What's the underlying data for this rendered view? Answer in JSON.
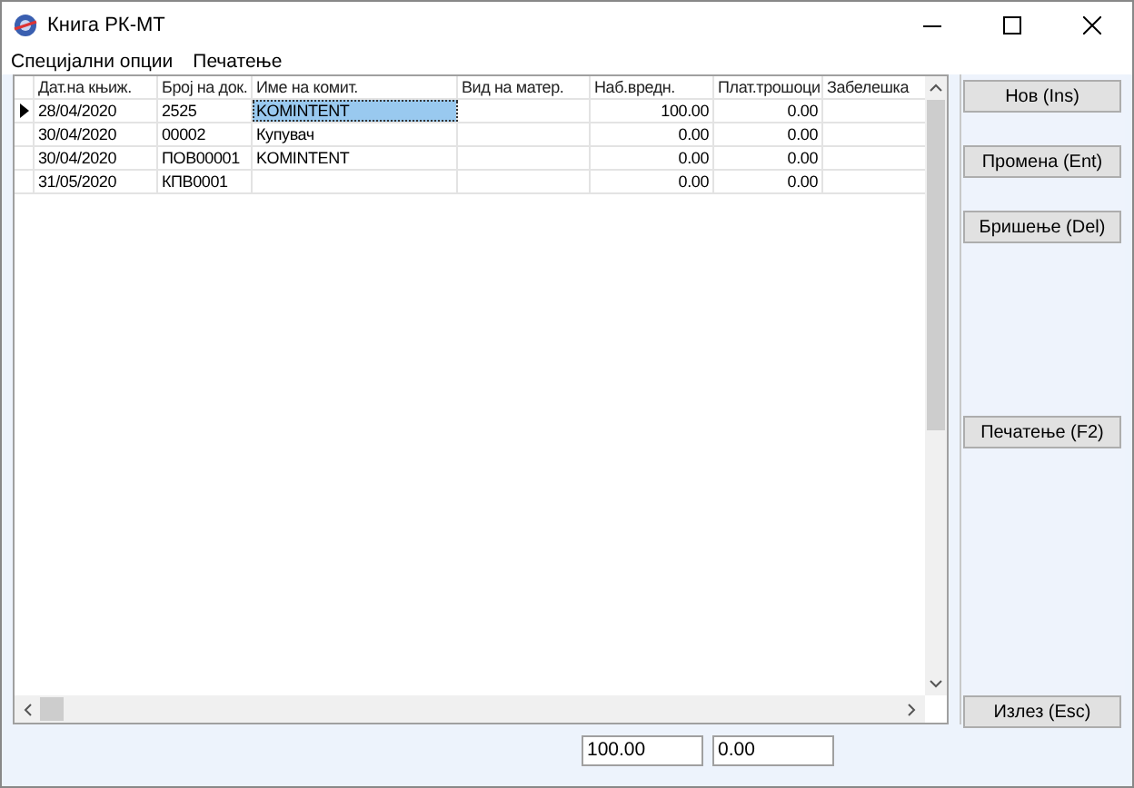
{
  "window": {
    "title": "Книга РК-МТ"
  },
  "menu": [
    "Специјални опции",
    "Печатење"
  ],
  "table": {
    "columns": [
      "Дат.на књиж.",
      "Број на док.",
      "Име на комит.",
      "Вид на матер.",
      "Наб.вредн.",
      "Плат.трошоци",
      "Забелешка"
    ],
    "rows": [
      {
        "current": true,
        "client_selected": true,
        "date": "28/04/2020",
        "doc_no": "2525",
        "client": "KOMINTENT",
        "value": "100.00",
        "costs": "0.00"
      },
      {
        "current": false,
        "client_selected": false,
        "date": "30/04/2020",
        "doc_no": "00002",
        "client": "Купувач",
        "value": "0.00",
        "costs": "0.00"
      },
      {
        "current": false,
        "client_selected": false,
        "date": "30/04/2020",
        "doc_no": "ПОВ00001",
        "client": "KOMINTENT",
        "value": "0.00",
        "costs": "0.00"
      },
      {
        "current": false,
        "client_selected": false,
        "date": "31/05/2020",
        "doc_no": "КПВ0001",
        "value": "0.00",
        "costs": "0.00"
      }
    ]
  },
  "buttons": [
    "Нов (Ins)",
    "Промена (Ent)",
    "Бришење (Del)",
    "Печатење (F2)",
    "Излез (Esc)"
  ],
  "totals": [
    {
      "value": "100.00"
    },
    {
      "value": "0.00"
    }
  ]
}
